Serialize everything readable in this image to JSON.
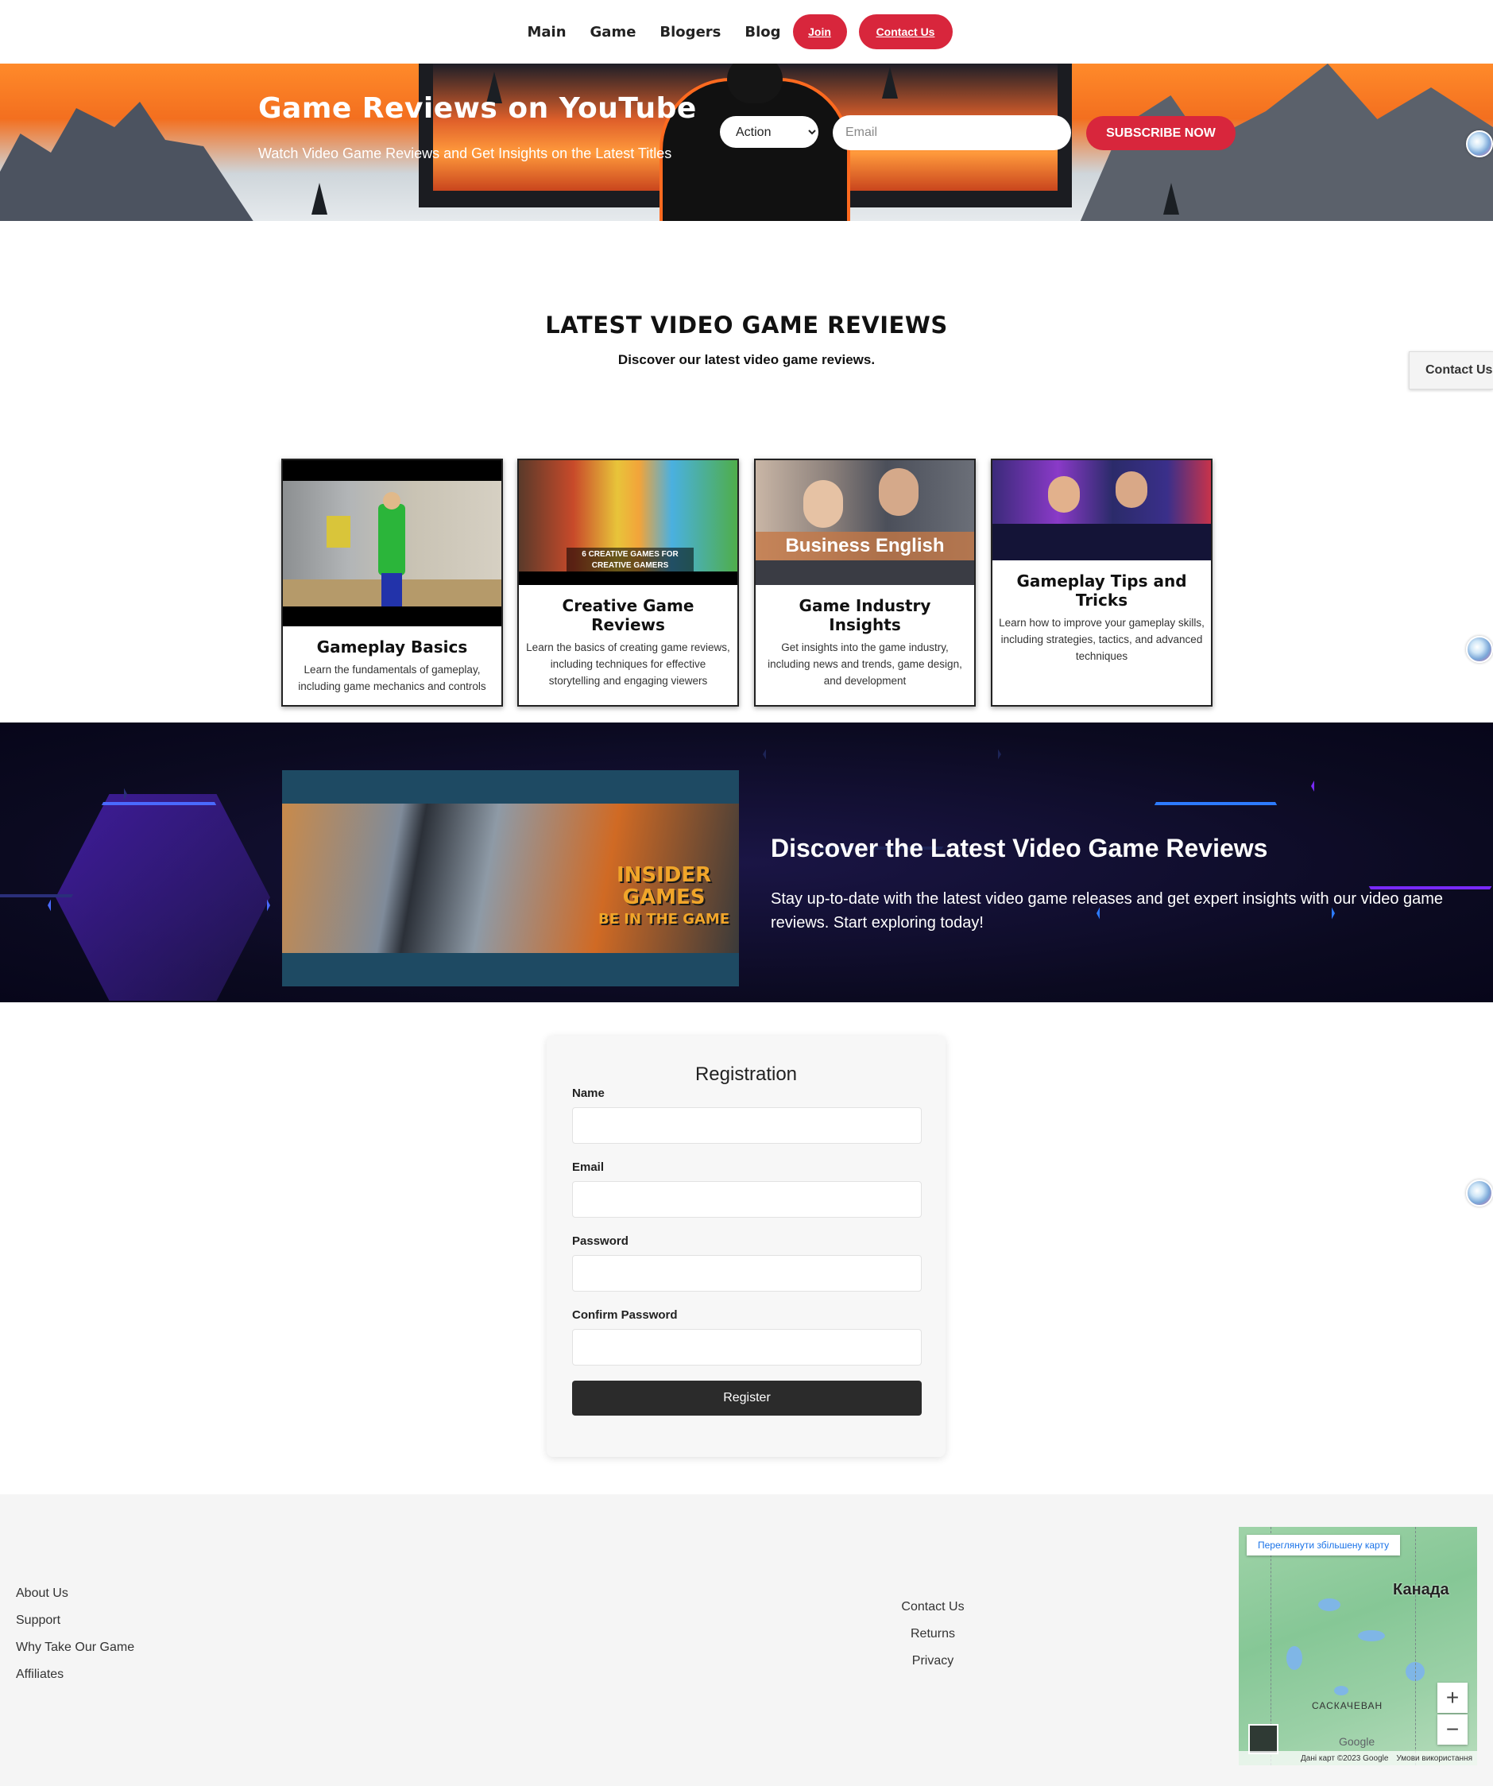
{
  "nav": {
    "links": [
      "Main",
      "Game",
      "Blogers",
      "Blog"
    ],
    "join": "Join",
    "contact": "Contact Us"
  },
  "hero": {
    "title": "Game Reviews on YouTube",
    "subtitle": "Watch Video Game Reviews and Get Insights on the Latest Titles",
    "genre_selected": "Action",
    "email_placeholder": "Email",
    "subscribe": "SUBSCRIBE NOW"
  },
  "latest": {
    "title": "LATEST VIDEO GAME REVIEWS",
    "subtitle": "Discover our latest video game reviews.",
    "contact_tab": "Contact Us"
  },
  "cards": [
    {
      "title": "Gameplay Basics",
      "text": "Learn the fundamentals of gameplay, including game mechanics and controls"
    },
    {
      "title": "Creative Game Reviews",
      "text": "Learn the basics of creating game reviews, including techniques for effective storytelling and engaging viewers",
      "image_caption": "6 CREATIVE GAMES FOR CREATIVE GAMERS"
    },
    {
      "title": "Game Industry Insights",
      "text": "Get insights into the game industry, including news and trends, game design, and development",
      "image_caption": "Business English"
    },
    {
      "title": "Gameplay Tips and Tricks",
      "text": "Learn how to improve your gameplay skills, including strategies, tactics, and advanced techniques"
    }
  ],
  "feature": {
    "title": "Discover the Latest Video Game Reviews",
    "text": "Stay up-to-date with the latest video game releases and get expert insights with our video game reviews. Start exploring today!",
    "image_text_1": "INSIDER",
    "image_text_2": "GAMES",
    "image_text_3": "BE IN THE GAME"
  },
  "registration": {
    "title": "Registration",
    "fields": [
      "Name",
      "Email",
      "Password",
      "Confirm Password"
    ],
    "button": "Register"
  },
  "footer": {
    "left_links": [
      "About Us",
      "Support",
      "Why Take Our Game",
      "Affiliates"
    ],
    "mid_links": [
      "Contact Us",
      "Returns",
      "Privacy"
    ]
  },
  "map": {
    "view_larger": "Переглянути збільшену карту",
    "country": "Канада",
    "region": "САСКАЧЕВАН",
    "logo": "Google",
    "data": "Дані карт ©2023 Google",
    "terms": "Умови використання",
    "zoom_in": "+",
    "zoom_out": "−"
  }
}
